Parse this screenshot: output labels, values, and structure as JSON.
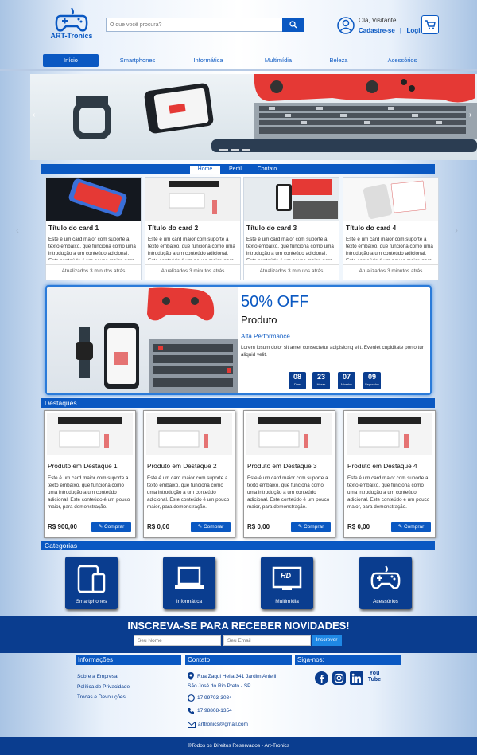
{
  "header": {
    "logo_text": "ART-Tronics",
    "search_placeholder": "O que você procura?",
    "greeting": "Olá, Visitante!",
    "signup": "Cadastre-se",
    "separator": "|",
    "login": "Login"
  },
  "nav": {
    "items": [
      "Início",
      "Smartphones",
      "Informática",
      "Multimídia",
      "Beleza",
      "Acessórios"
    ]
  },
  "tabs": [
    "Home",
    "Perfil",
    "Contato"
  ],
  "cards": [
    {
      "title": "Título do card 1",
      "text": "Este é um card maior com suporte a texto embaixo, que funciona como uma introdução a um conteúdo adicional. Este conteúdo é um pouco maior, para demonstração.",
      "footer": "Atualizados 3 minutos atrás"
    },
    {
      "title": "Título do card 2",
      "text": "Este é um card maior com suporte a texto embaixo, que funciona como uma introdução a um conteúdo adicional. Este conteúdo é um pouco maior, para demonstração.",
      "footer": "Atualizados 3 minutos atrás"
    },
    {
      "title": "Título do card 3",
      "text": "Este é um card maior com suporte a texto embaixo, que funciona como uma introdução a um conteúdo adicional. Este conteúdo é um pouco maior, para demonstração.",
      "footer": "Atualizados 3 minutos atrás"
    },
    {
      "title": "Título do card 4",
      "text": "Este é um card maior com suporte a texto embaixo, que funciona como uma introdução a um conteúdo adicional. Este conteúdo é um pouco maior, para demonstração.",
      "footer": "Atualizados 3 minutos atrás"
    }
  ],
  "promo": {
    "discount": "50% OFF",
    "product": "Produto",
    "subtitle": "Alta Performance",
    "text": "Lorem ipsum dolor sit amet consectetur adipisicing elit. Eveniet cupiditate porro tur aliquid velit.",
    "countdown": [
      {
        "value": "08",
        "unit": "Dias"
      },
      {
        "value": "23",
        "unit": "Horas"
      },
      {
        "value": "07",
        "unit": "Minutos"
      },
      {
        "value": "09",
        "unit": "Segundos"
      }
    ]
  },
  "highlights": {
    "title": "Destaques",
    "products": [
      {
        "title": "Produto em Destaque 1",
        "text": "Este é um card maior com suporte a texto embaixo, que funciona como uma introdução a um conteúdo adicional. Este conteúdo é um pouco maior, para demonstração.",
        "price": "R$ 900,00",
        "buy": "Comprar"
      },
      {
        "title": "Produto em Destaque 2",
        "text": "Este é um card maior com suporte a texto embaixo, que funciona como uma introdução a um conteúdo adicional. Este conteúdo é um pouco maior, para demonstração.",
        "price": "R$ 0,00",
        "buy": "Comprar"
      },
      {
        "title": "Produto em Destaque 3",
        "text": "Este é um card maior com suporte a texto embaixo, que funciona como uma introdução a um conteúdo adicional. Este conteúdo é um pouco maior, para demonstração.",
        "price": "R$ 0,00",
        "buy": "Comprar"
      },
      {
        "title": "Produto em Destaque 4",
        "text": "Este é um card maior com suporte a texto embaixo, que funciona como uma introdução a um conteúdo adicional. Este conteúdo é um pouco maior, para demonstração.",
        "price": "R$ 0,00",
        "buy": "Comprar"
      }
    ]
  },
  "categories": {
    "title": "Categorias",
    "items": [
      "Smartphones",
      "Informática",
      "Multimídia",
      "Acessórios"
    ],
    "hd_label": "HD"
  },
  "newsletter": {
    "title": "INSCREVA-SE PARA RECEBER NOVIDADES!",
    "name_placeholder": "Seu Nome",
    "email_placeholder": "Seu Email",
    "button": "Inscrever"
  },
  "footer": {
    "info_title": "Informações",
    "contact_title": "Contato",
    "social_title": "Siga-nos:",
    "links": [
      "Sobre a Empresa",
      "Política de Privacidade",
      "Trocas e Devoluções"
    ],
    "address_line1": "Rua Zaqui Hella 341 Jardim Anielli",
    "address_line2": "São José do Rio Preto - SP",
    "whatsapp": "17 99703-3084",
    "phone": "17 98808-1354",
    "email": "arttronics@gmail.com",
    "copyright": "©Todos os Direitos Reservados - Art-Tronics",
    "youtube_label": "You Tube"
  },
  "colors": {
    "primary": "#0a58c2",
    "dark": "#0a3d8f"
  }
}
